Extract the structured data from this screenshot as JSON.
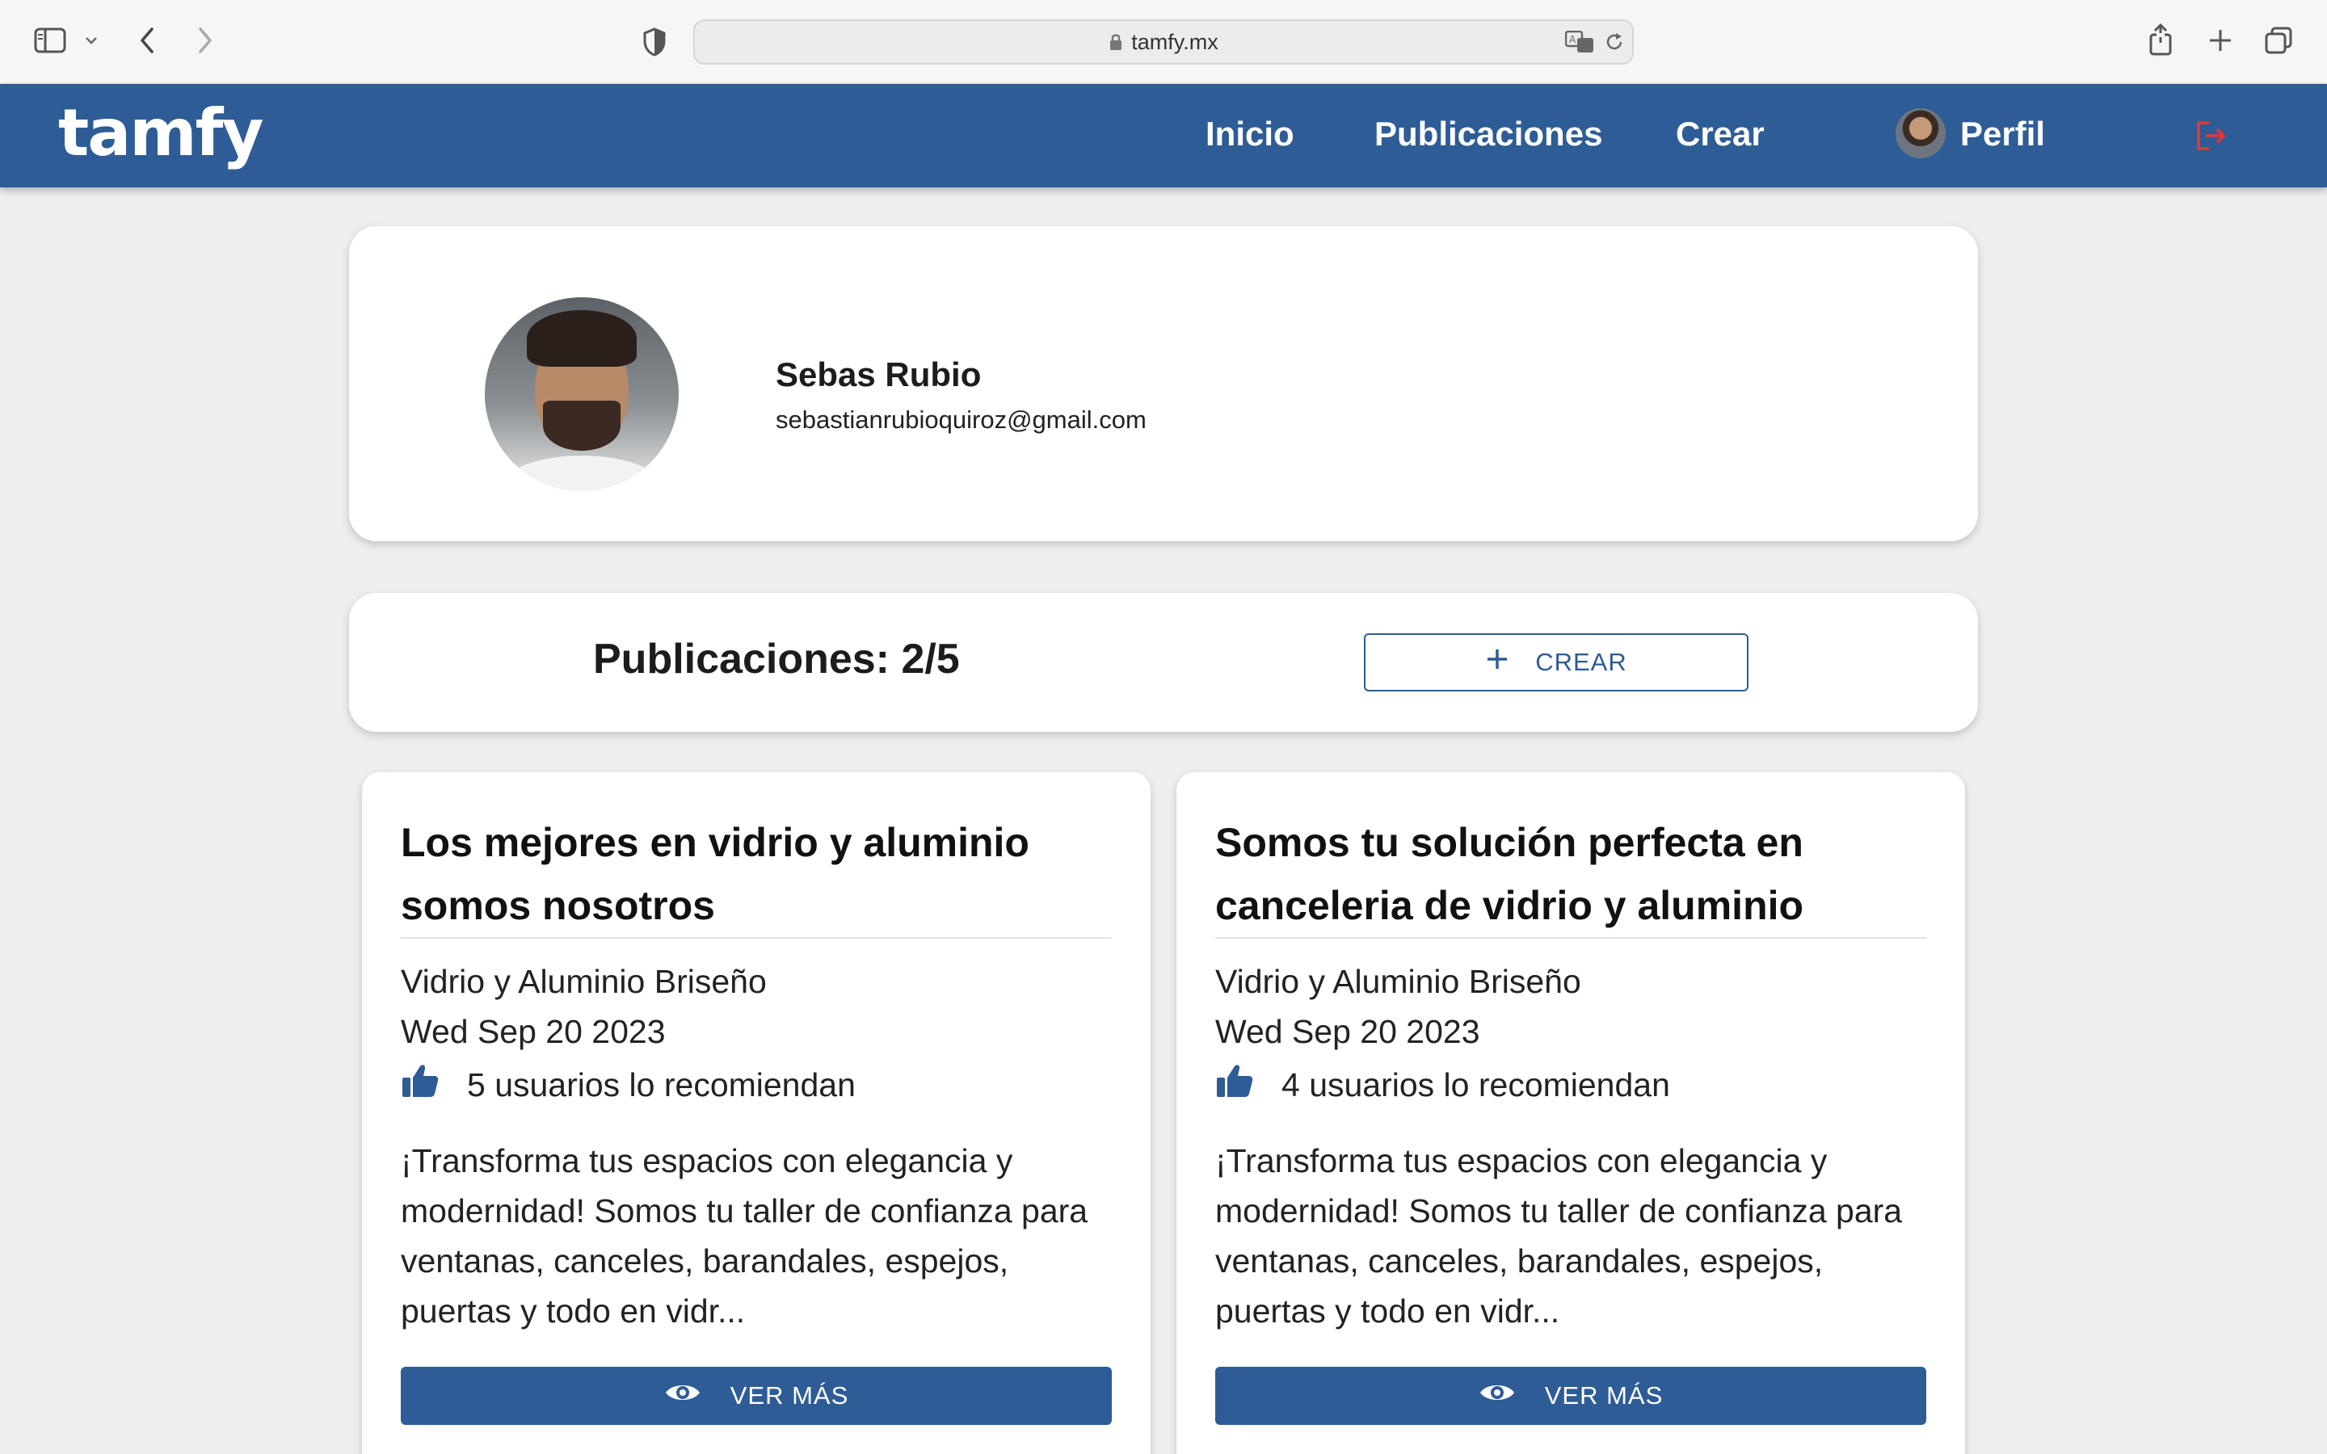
{
  "browser": {
    "url": "tamfy.mx",
    "icons": [
      "sidebar-icon",
      "chevron-down-icon",
      "back-icon",
      "forward-icon",
      "shield-icon",
      "lock-icon",
      "translate-icon",
      "reload-icon",
      "share-icon",
      "new-tab-icon",
      "tabs-overview-icon"
    ]
  },
  "header": {
    "logo": "tamfy",
    "nav": {
      "inicio": "Inicio",
      "publicaciones": "Publicaciones",
      "crear": "Crear",
      "perfil": "Perfil"
    },
    "colors": {
      "bar": "#2e5c96",
      "logout": "#e53935"
    }
  },
  "profile": {
    "name": "Sebas Rubio",
    "email": "sebastianrubioquiroz@gmail.com"
  },
  "publications": {
    "count_label": "Publicaciones: 2/5",
    "create_label": "CREAR"
  },
  "posts": [
    {
      "title": "Los mejores en vidrio y aluminio somos nosotros",
      "author": "Vidrio y Aluminio Briseño",
      "date": "Wed Sep 20 2023",
      "recommendations": "5 usuarios lo recomiendan",
      "description": "¡Transforma tus espacios con elegancia y modernidad! Somos tu taller de confianza para ventanas, canceles, barandales, espejos, puertas y todo en vidr...",
      "action": "VER MÁS"
    },
    {
      "title": "Somos tu solución perfecta en canceleria de vidrio y aluminio",
      "author": "Vidrio y Aluminio Briseño",
      "date": "Wed Sep 20 2023",
      "recommendations": "4 usuarios lo recomiendan",
      "description": "¡Transforma tus espacios con elegancia y modernidad! Somos tu taller de confianza para ventanas, canceles, barandales, espejos, puertas y todo en vidr...",
      "action": "VER MÁS"
    }
  ]
}
